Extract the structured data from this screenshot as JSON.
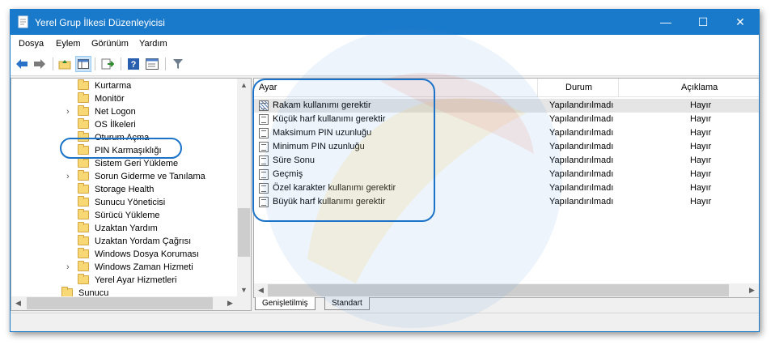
{
  "window": {
    "title": "Yerel Grup İlkesi Düzenleyicisi",
    "controls": {
      "minimize": "—",
      "maximize": "☐",
      "close": "✕"
    }
  },
  "menu": [
    "Dosya",
    "Eylem",
    "Görünüm",
    "Yardım"
  ],
  "toolbar": {
    "icons": [
      "back-arrow-icon",
      "forward-arrow-icon",
      "up-folder-icon",
      "show-hide-tree-icon",
      "export-list-icon",
      "help-icon",
      "properties-icon",
      "filter-icon"
    ]
  },
  "tree": {
    "items": [
      {
        "label": "Kurtarma",
        "expandable": false
      },
      {
        "label": "Monitör",
        "expandable": false
      },
      {
        "label": "Net Logon",
        "expandable": true
      },
      {
        "label": "OS İlkeleri",
        "expandable": false
      },
      {
        "label": "Oturum Açma",
        "expandable": false
      },
      {
        "label": "PIN Karmaşıklığı",
        "expandable": false,
        "selected": true
      },
      {
        "label": "Sistem Geri Yükleme",
        "expandable": false
      },
      {
        "label": "Sorun Giderme ve Tanılama",
        "expandable": true
      },
      {
        "label": "Storage Health",
        "expandable": false
      },
      {
        "label": "Sunucu Yöneticisi",
        "expandable": false
      },
      {
        "label": "Sürücü Yükleme",
        "expandable": false
      },
      {
        "label": "Uzaktan Yardım",
        "expandable": false
      },
      {
        "label": "Uzaktan Yordam Çağrısı",
        "expandable": false
      },
      {
        "label": "Windows Dosya Koruması",
        "expandable": false
      },
      {
        "label": "Windows Zaman Hizmeti",
        "expandable": true
      },
      {
        "label": "Yerel Ayar Hizmetleri",
        "expandable": false
      },
      {
        "label": "Sunucu",
        "expandable": false
      }
    ]
  },
  "list": {
    "columns": {
      "name": "Ayar",
      "state": "Durum",
      "comment": "Açıklama"
    },
    "rows": [
      {
        "name": "Rakam kullanımı gerektir",
        "state": "Yapılandırılmadı",
        "comment": "Hayır"
      },
      {
        "name": "Küçük harf kullanımı gerektir",
        "state": "Yapılandırılmadı",
        "comment": "Hayır"
      },
      {
        "name": "Maksimum PIN uzunluğu",
        "state": "Yapılandırılmadı",
        "comment": "Hayır"
      },
      {
        "name": "Minimum PIN uzunluğu",
        "state": "Yapılandırılmadı",
        "comment": "Hayır"
      },
      {
        "name": "Süre Sonu",
        "state": "Yapılandırılmadı",
        "comment": "Hayır"
      },
      {
        "name": "Geçmiş",
        "state": "Yapılandırılmadı",
        "comment": "Hayır"
      },
      {
        "name": "Özel karakter kullanımı gerektir",
        "state": "Yapılandırılmadı",
        "comment": "Hayır"
      },
      {
        "name": "Büyük harf kullanımı gerektir",
        "state": "Yapılandırılmadı",
        "comment": "Hayır"
      }
    ]
  },
  "tabs": [
    "Genişletilmiş",
    "Standart"
  ],
  "colors": {
    "titlebar": "#1979ca",
    "annotation": "#1a73c8"
  }
}
